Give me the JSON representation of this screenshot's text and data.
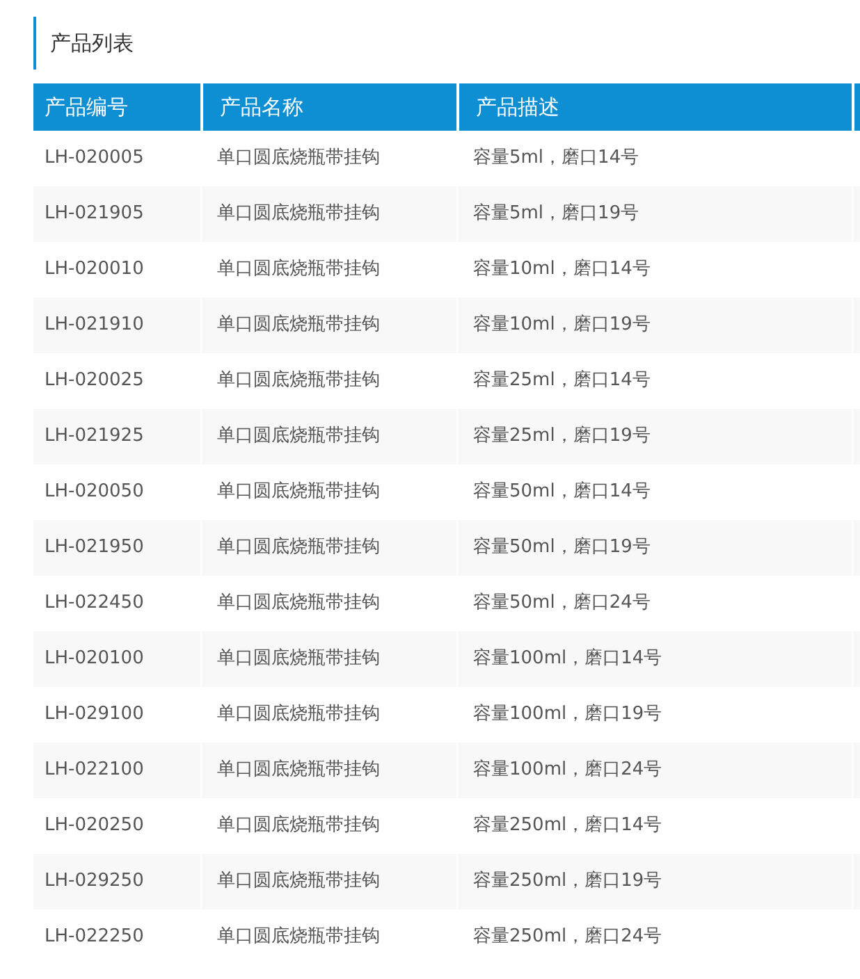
{
  "section_title": "产品列表",
  "table": {
    "columns": [
      "产品编号",
      "产品名称",
      "产品描述"
    ],
    "rows": [
      [
        "LH-020005",
        "单口圆底烧瓶带挂钩",
        "容量5ml，磨口14号"
      ],
      [
        "LH-021905",
        "单口圆底烧瓶带挂钩",
        "容量5ml，磨口19号"
      ],
      [
        "LH-020010",
        "单口圆底烧瓶带挂钩",
        "容量10ml，磨口14号"
      ],
      [
        "LH-021910",
        "单口圆底烧瓶带挂钩",
        "容量10ml，磨口19号"
      ],
      [
        "LH-020025",
        "单口圆底烧瓶带挂钩",
        "容量25ml，磨口14号"
      ],
      [
        "LH-021925",
        "单口圆底烧瓶带挂钩",
        "容量25ml，磨口19号"
      ],
      [
        "LH-020050",
        "单口圆底烧瓶带挂钩",
        "容量50ml，磨口14号"
      ],
      [
        "LH-021950",
        "单口圆底烧瓶带挂钩",
        "容量50ml，磨口19号"
      ],
      [
        "LH-022450",
        "单口圆底烧瓶带挂钩",
        "容量50ml，磨口24号"
      ],
      [
        "LH-020100",
        "单口圆底烧瓶带挂钩",
        "容量100ml，磨口14号"
      ],
      [
        "LH-029100",
        "单口圆底烧瓶带挂钩",
        "容量100ml，磨口19号"
      ],
      [
        "LH-022100",
        "单口圆底烧瓶带挂钩",
        "容量100ml，磨口24号"
      ],
      [
        "LH-020250",
        "单口圆底烧瓶带挂钩",
        "容量250ml，磨口14号"
      ],
      [
        "LH-029250",
        "单口圆底烧瓶带挂钩",
        "容量250ml，磨口19号"
      ],
      [
        "LH-022250",
        "单口圆底烧瓶带挂钩",
        "容量250ml，磨口24号"
      ]
    ]
  }
}
